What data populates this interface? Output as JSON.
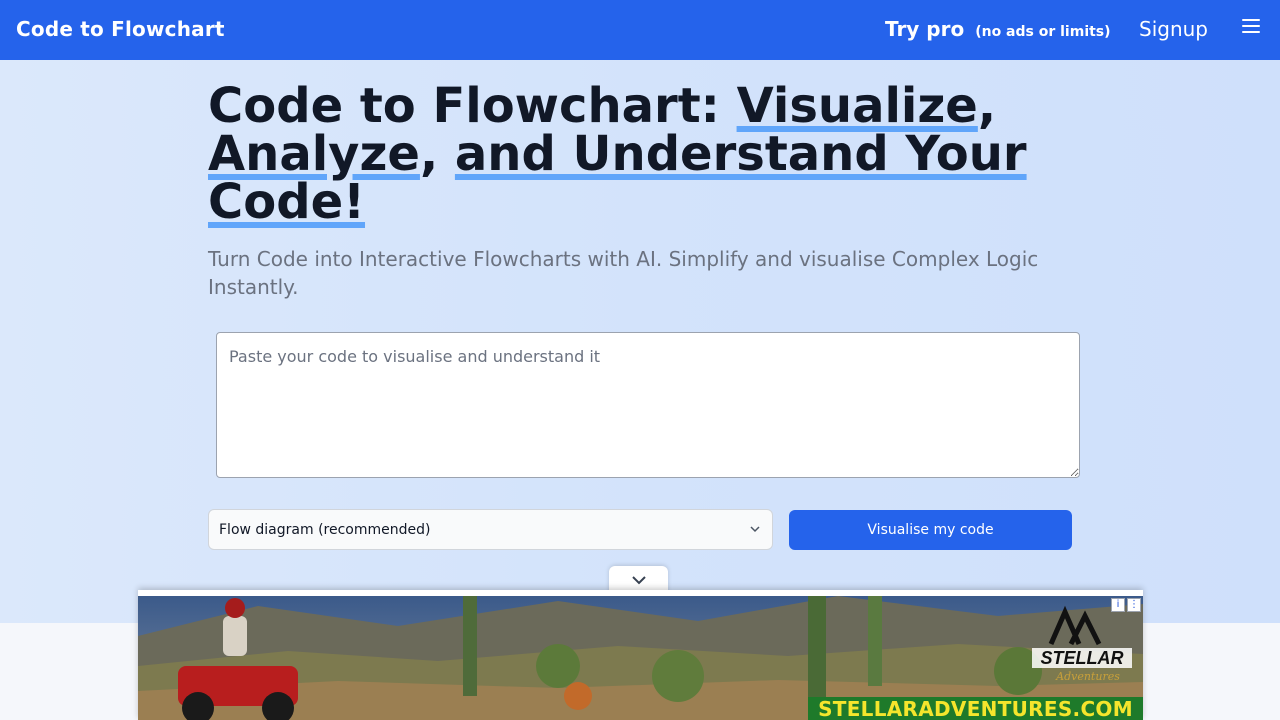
{
  "header": {
    "brand": "Code to Flowchart",
    "try_pro": "Try pro",
    "try_pro_note": "(no ads or limits)",
    "signup": "Signup",
    "menu_icon": "hamburger-menu-icon"
  },
  "hero": {
    "title_plain_1": "Code to Flowchart: ",
    "title_u_1": "Visualize",
    "title_plain_2": ",",
    "title_u_2": "Analyze",
    "title_plain_3": ", ",
    "title_u_3": "and Understand Your",
    "title_u_4": "Code!",
    "subtitle": "Turn Code into Interactive Flowcharts with AI. Simplify and visualise Complex Logic Instantly."
  },
  "form": {
    "code_placeholder": "Paste your code to visualise and understand it",
    "code_value": "",
    "diagram_type": "Flow diagram (recommended)",
    "submit_label": "Visualise my code"
  },
  "ad": {
    "banner_text": "STELLARADVENTURES.COM",
    "logo_text": "STELLAR",
    "logo_sub": "Adventures"
  },
  "colors": {
    "primary": "#2563eb",
    "underline": "#60a5fa",
    "hero_bg": "#d3e3fb"
  }
}
